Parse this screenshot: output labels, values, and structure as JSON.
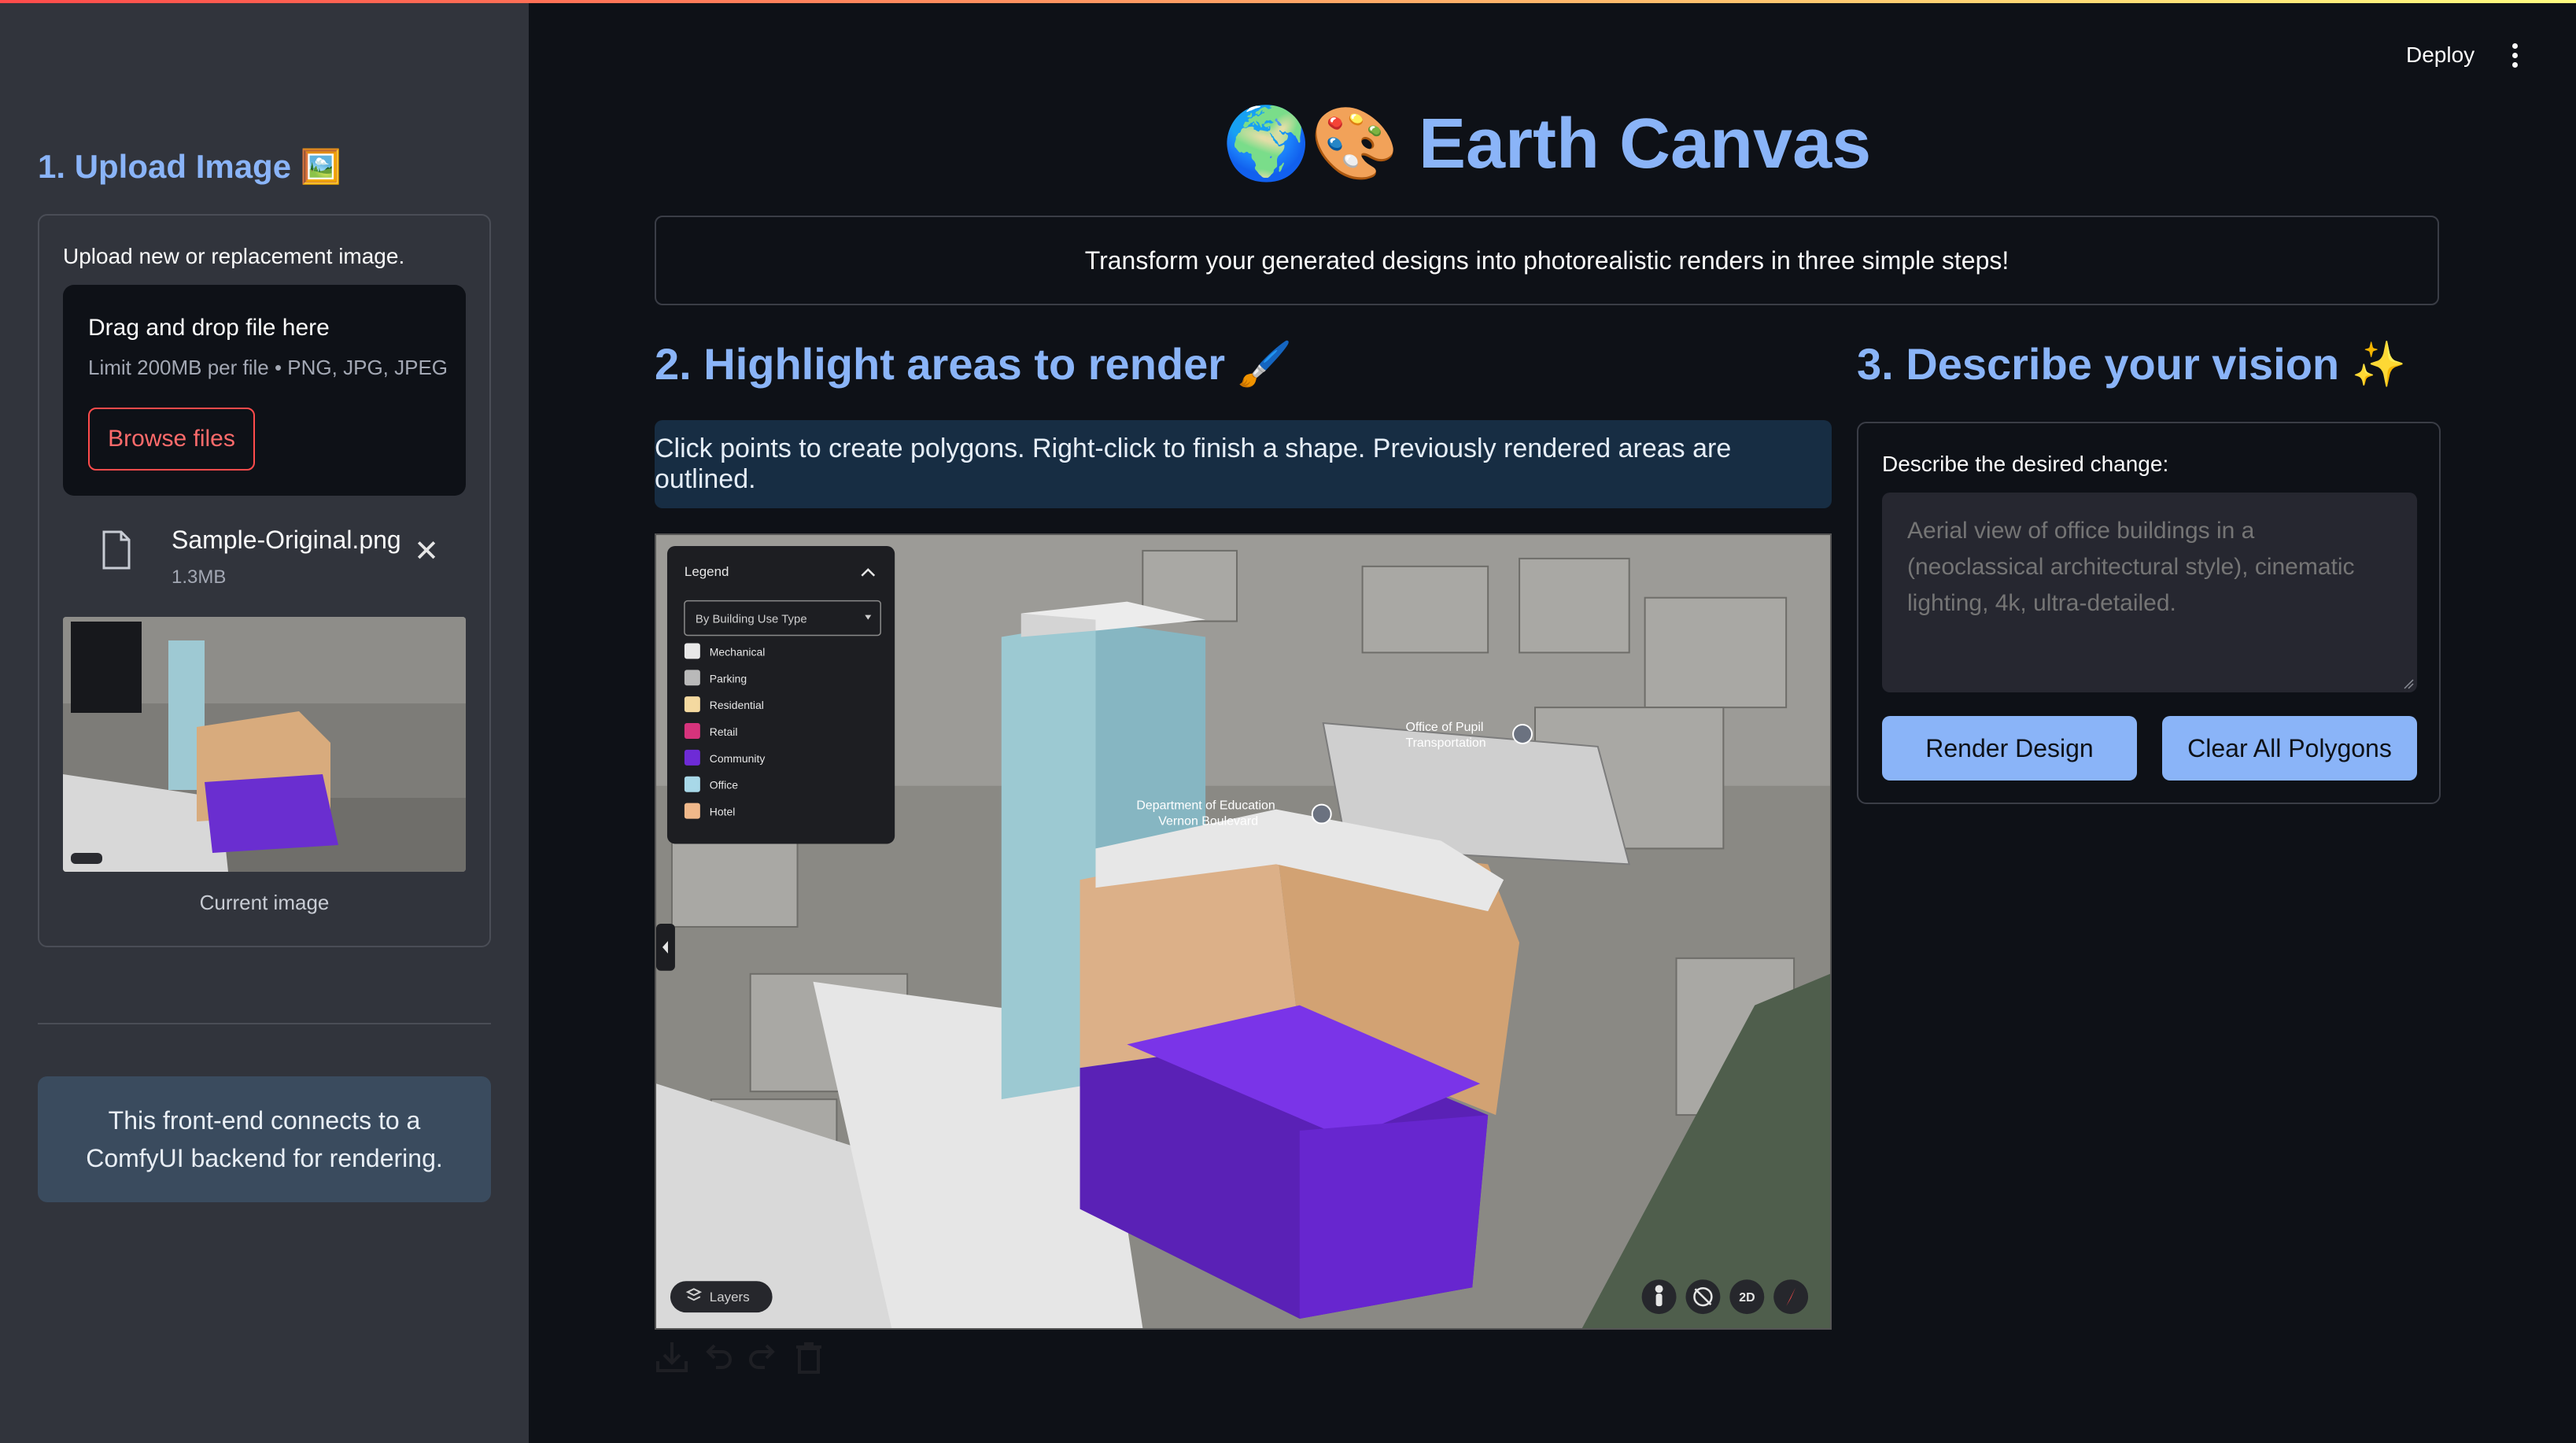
{
  "app": {
    "title_emoji": "🌍🎨",
    "title": "Earth Canvas",
    "subtitle": "Transform your generated designs into photorealistic renders in three simple steps!"
  },
  "header": {
    "deploy_label": "Deploy"
  },
  "sidebar": {
    "heading": "1. Upload Image 🖼️",
    "uploader_label": "Upload new or replacement image.",
    "dropzone_title": "Drag and drop file here",
    "dropzone_limit": "Limit 200MB per file • PNG, JPG, JPEG",
    "browse_label": "Browse files",
    "file": {
      "name": "Sample-Original.png",
      "size": "1.3MB"
    },
    "thumbnail_caption": "Current image",
    "info": "This front-end connects to a ComfyUI backend for rendering."
  },
  "step2": {
    "heading": "2. Highlight areas to render 🖌️",
    "instructions": "Click points to create polygons. Right-click to finish a shape. Previously rendered areas are outlined.",
    "map": {
      "legend_title": "Legend",
      "legend_select": "By Building Use Type",
      "legend_items": [
        {
          "label": "Mechanical",
          "color": "#e8e8e8"
        },
        {
          "label": "Parking",
          "color": "#b9b9b9"
        },
        {
          "label": "Residential",
          "color": "#f4d9a0"
        },
        {
          "label": "Retail",
          "color": "#d6337c"
        },
        {
          "label": "Community",
          "color": "#6e2bd6"
        },
        {
          "label": "Office",
          "color": "#a8d8e8"
        },
        {
          "label": "Hotel",
          "color": "#f0b88a"
        }
      ],
      "labels": [
        {
          "lines": [
            "Office of Pupil",
            "Transportation"
          ]
        },
        {
          "lines": [
            "Department of Education",
            "Vernon Boulevard"
          ]
        }
      ],
      "layers_label": "Layers",
      "view_2d_label": "2D"
    }
  },
  "step3": {
    "heading": "3. Describe your vision ✨",
    "label": "Describe the desired change:",
    "placeholder": "Aerial view of office buildings in a (neoclassical architectural style), cinematic lighting, 4k, ultra-detailed.",
    "render_label": "Render Design",
    "clear_label": "Clear All Polygons"
  },
  "colors": {
    "accent": "#8ab4f8",
    "background": "#0e1117",
    "sidebar": "#31343c",
    "browse": "#ff4b4b"
  }
}
